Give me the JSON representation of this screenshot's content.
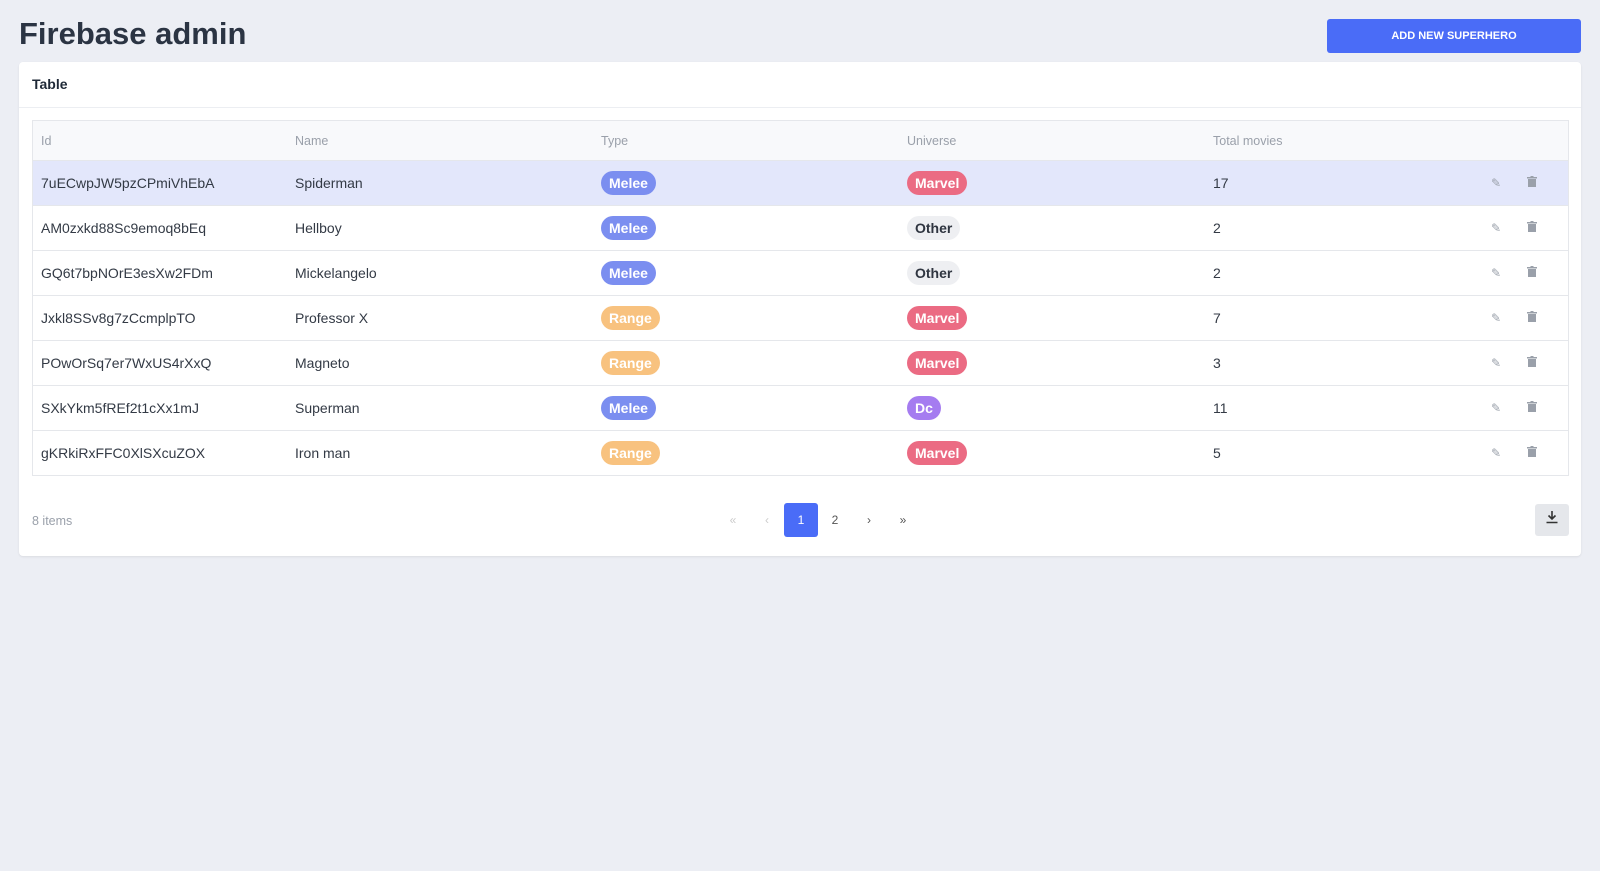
{
  "header": {
    "title": "Firebase admin",
    "add_button": "ADD NEW SUPERHERO"
  },
  "card": {
    "title": "Table"
  },
  "columns": [
    "Id",
    "Name",
    "Type",
    "Universe",
    "Total movies"
  ],
  "rows": [
    {
      "id": "7uECwpJW5pzCPmiVhEbA",
      "name": "Spiderman",
      "type": "Melee",
      "universe": "Marvel",
      "movies": "17"
    },
    {
      "id": "AM0zxkd88Sc9emoq8bEq",
      "name": "Hellboy",
      "type": "Melee",
      "universe": "Other",
      "movies": "2"
    },
    {
      "id": "GQ6t7bpNOrE3esXw2FDm",
      "name": "Mickelangelo",
      "type": "Melee",
      "universe": "Other",
      "movies": "2"
    },
    {
      "id": "Jxkl8SSv8g7zCcmplpTO",
      "name": "Professor X",
      "type": "Range",
      "universe": "Marvel",
      "movies": "7"
    },
    {
      "id": "POwOrSq7er7WxUS4rXxQ",
      "name": "Magneto",
      "type": "Range",
      "universe": "Marvel",
      "movies": "3"
    },
    {
      "id": "SXkYkm5fREf2t1cXx1mJ",
      "name": "Superman",
      "type": "Melee",
      "universe": "Dc",
      "movies": "11"
    },
    {
      "id": "gKRkiRxFFC0XlSXcuZOX",
      "name": "Iron man",
      "type": "Range",
      "universe": "Marvel",
      "movies": "5"
    }
  ],
  "footer": {
    "count": "8 items",
    "pages": [
      "1",
      "2"
    ],
    "first": "«",
    "prev": "‹",
    "next": "›",
    "last": "»",
    "current_page": "1"
  },
  "colors": {
    "accent": "#4a6cf7",
    "melee": "#7b8ef0",
    "range": "#f8c27f",
    "marvel": "#eb6b83",
    "dc": "#a57cf0"
  }
}
